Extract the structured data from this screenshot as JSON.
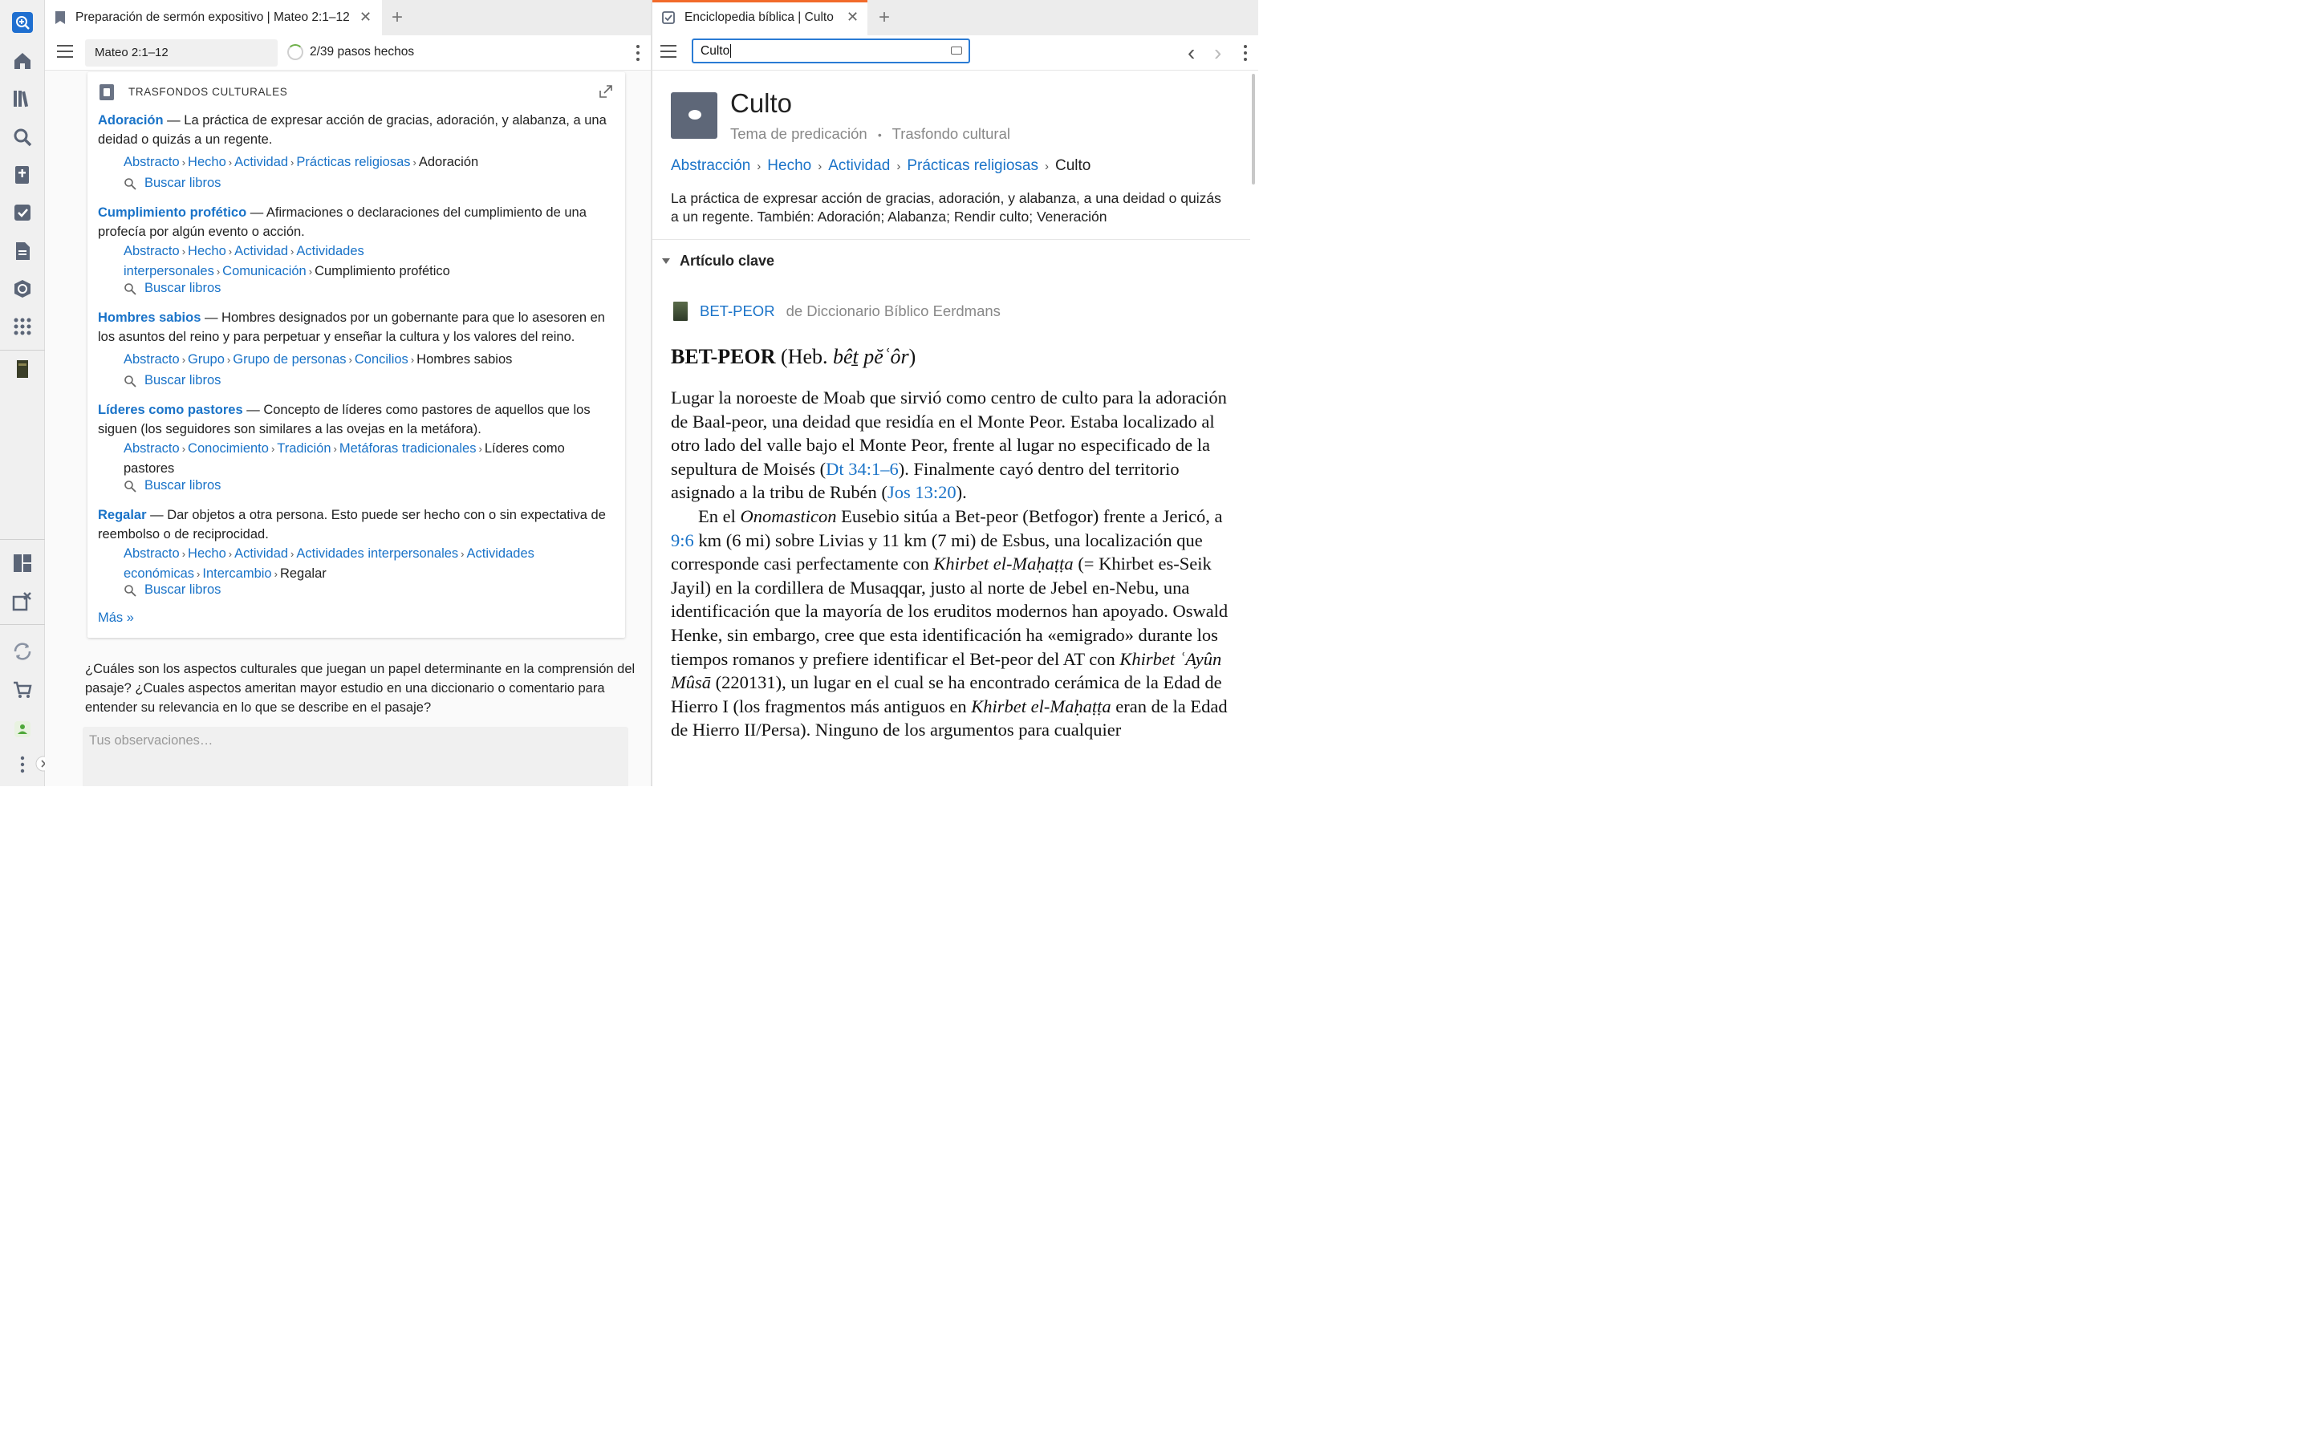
{
  "left_tab": {
    "title": "Preparación de sermón expositivo | Mateo 2:1–12",
    "close": "✕",
    "add": "+"
  },
  "right_tab": {
    "title": "Enciclopedia bíblica | Culto",
    "close": "✕",
    "add": "+"
  },
  "left_toolbar": {
    "reference": "Mateo 2:1–12",
    "progress": "2/39 pasos hechos"
  },
  "card": {
    "title": "TRASFONDOS CULTURALES",
    "buscar_label": "Buscar libros",
    "more_label": "Más »",
    "entries": [
      {
        "term": "Adoración",
        "desc": " — La práctica de expresar acción de gracias, adoración, y alabanza, a una deidad o quizás a un regente.",
        "crumbs": [
          "Abstracto",
          "Hecho",
          "Actividad",
          "Prácticas religiosas"
        ],
        "leaf": "Adoración"
      },
      {
        "term": "Cumplimiento profético",
        "desc": " — Afirmaciones o declaraciones del cumplimiento de una profecía por algún evento o acción.",
        "crumbs": [
          "Abstracto",
          "Hecho",
          "Actividad",
          "Actividades interpersonales",
          "Comunicación"
        ],
        "leaf": "Cumplimiento profético"
      },
      {
        "term": "Hombres sabios",
        "desc": " — Hombres designados por un gobernante para que lo asesoren en los asuntos del reino y para perpetuar y enseñar la cultura y los valores del reino.",
        "crumbs": [
          "Abstracto",
          "Grupo",
          "Grupo de personas",
          "Concilios"
        ],
        "leaf": "Hombres sabios"
      },
      {
        "term": "Líderes como pastores",
        "desc": " — Concepto de líderes como pastores de aquellos que los siguen (los seguidores son similares a las ovejas en la metáfora).",
        "crumbs": [
          "Abstracto",
          "Conocimiento",
          "Tradición",
          "Metáforas tradicionales"
        ],
        "leaf": "Líderes como pastores"
      },
      {
        "term": "Regalar",
        "desc": " — Dar objetos a otra persona. Esto puede ser hecho con o sin expectativa de reembolso o de reciprocidad.",
        "crumbs": [
          "Abstracto",
          "Hecho",
          "Actividad",
          "Actividades interpersonales",
          "Actividades económicas",
          "Intercambio"
        ],
        "leaf": "Regalar"
      }
    ]
  },
  "question": "¿Cuáles son los aspectos culturales que juegan un papel determinante en la comprensión del pasaje? ¿Cuales aspectos ameritan mayor estudio en una diccionario o comentario para entender su relevancia en lo que se describe en el pasaje?",
  "observations_placeholder": "Tus observaciones…",
  "right_toolbar": {
    "search_value": "Culto",
    "back": "‹",
    "forward": "›"
  },
  "topic": {
    "title": "Culto",
    "subtitle_a": "Tema de predicación",
    "subtitle_sep": "•",
    "subtitle_b": "Trasfondo cultural",
    "crumbs": [
      "Abstracción",
      "Hecho",
      "Actividad",
      "Prácticas religiosas"
    ],
    "leaf": "Culto",
    "description": "La práctica de expresar acción de gracias, adoración, y alabanza, a una deidad o quizás a un regente. También: Adoración; Alabanza; Rendir culto; Veneración"
  },
  "articulo": {
    "label": "Artículo clave",
    "source_title": "BET-PEOR",
    "source_from": "de Diccionario Bíblico Eerdmans",
    "head_bold": "BET-PEOR",
    "head_rest": " (Heb. ",
    "head_italic": "bêṯ pĕʿôr",
    "head_close": ")",
    "p1_a": "Lugar la noroeste de Moab que sirvió como centro de culto para la adoración de Baal-peor, una deidad que residía en el Monte Peor. Estaba localizado al otro lado del valle bajo el Monte Peor, frente al lugar no especificado de la sepultura de Moisés (",
    "p1_ref1": "Dt 34:1–6",
    "p1_b": "). Finalmente cayó dentro del territorio asignado a la tribu de Rubén (",
    "p1_ref2": "Jos 13:20",
    "p1_c": ").",
    "p2_a": "En el ",
    "p2_i1": "Onomasticon",
    "p2_b": " Eusebio sitúa a Bet-peor (Betfogor) frente a Jericó, a ",
    "p2_ref": "9:6",
    "p2_c": " km (6 mi) sobre Livias y 11 km (7 mi) de Esbus, una localización que corresponde casi perfectamente con ",
    "p2_i2": "Khirbet el-Maḥaṭṭa",
    "p2_d": " (= Khirbet es-Seik Jayil) en la cordillera de Musaqqar, justo al norte de Jebel en-Nebu, una identificación que la mayoría de los eruditos modernos han apoyado. Oswald Henke, sin embargo, cree que esta identificación ha «emigrado» durante los tiempos romanos y prefiere identificar el Bet-peor del AT con ",
    "p2_i3": "Khirbet ʿAyûn Mûsā",
    "p2_e": " (220131), un lugar en el cual se ha encontrado cerámica de la Edad de Hierro I (los fragmentos más antiguos en ",
    "p2_i4": "Khirbet el-Maḥaṭṭa",
    "p2_f": " eran de la Edad de Hierro II/Persa). Ninguno de los argumentos para cualquier"
  }
}
